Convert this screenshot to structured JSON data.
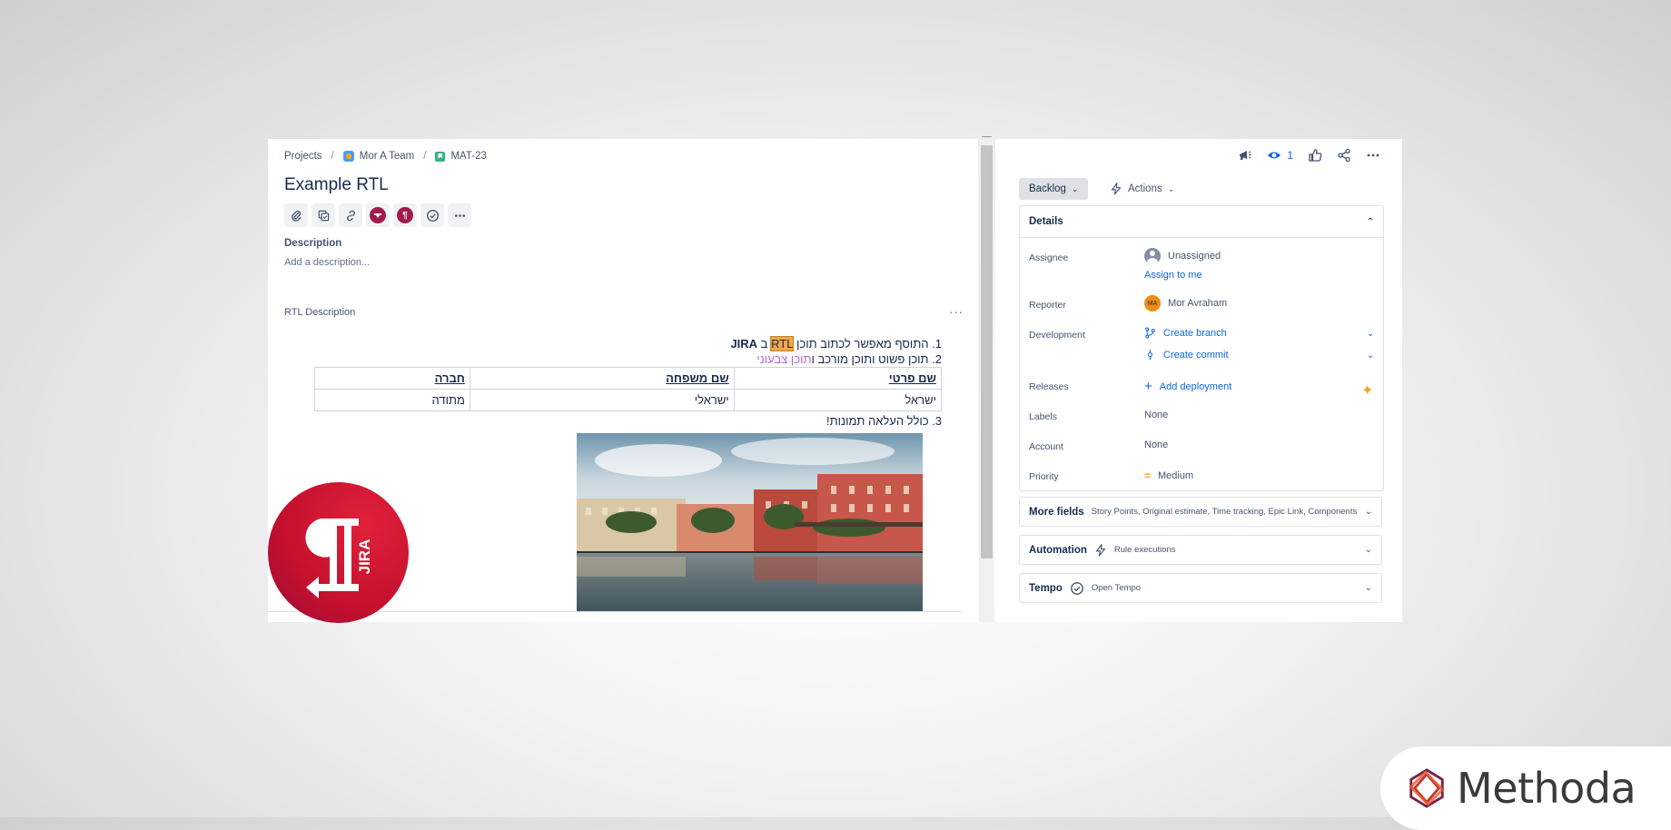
{
  "breadcrumb": {
    "projects": "Projects",
    "team": "Mor A Team",
    "issue_key": "MAT-23"
  },
  "issue": {
    "title": "Example RTL"
  },
  "toolbar": {
    "icons": [
      "paperclip-icon",
      "subtask-icon",
      "link-icon",
      "app-icon-1",
      "rtl-app-icon",
      "check-circle-icon",
      "more-icon"
    ]
  },
  "description": {
    "label": "Description",
    "placeholder": "Add a description..."
  },
  "rtl_field": {
    "label": "RTL Description",
    "more": "···",
    "line1_prefix": "1. התוסף מאפשר לכתוב תוכן ",
    "line1_highlight": "RTL",
    "line1_mid": " ב ",
    "line1_bold": "JIRA",
    "line2_prefix": "2. תוכן פשוט ותוכן מורכב ו",
    "line2_colored": "תוכן צבעוני",
    "table_headers": [
      "שם פרטי",
      "שם משפחה",
      "חברה"
    ],
    "table_row": [
      "ישראל",
      "ישראלי",
      "מתודה"
    ],
    "line3": "3. כולל העלאה תמונות!"
  },
  "sidebar": {
    "watch_count": "1",
    "status": "Backlog",
    "actions": "Actions",
    "details_title": "Details",
    "assignee_label": "Assignee",
    "assignee_value": "Unassigned",
    "assign_to_me": "Assign to me",
    "reporter_label": "Reporter",
    "reporter_initials": "MA",
    "reporter_value": "Mor Avraham",
    "development_label": "Development",
    "create_branch": "Create branch",
    "create_commit": "Create commit",
    "releases_label": "Releases",
    "add_deployment": "Add deployment",
    "labels_label": "Labels",
    "labels_value": "None",
    "account_label": "Account",
    "account_value": "None",
    "priority_label": "Priority",
    "priority_value": "Medium",
    "more_fields_title": "More fields",
    "more_fields_sub": "Story Points, Original estimate, Time tracking, Epic Link, Components, Fix ...",
    "automation_title": "Automation",
    "automation_sub": "Rule executions",
    "tempo_title": "Tempo",
    "tempo_sub": "Open Tempo"
  },
  "logo": {
    "text": "JIRA"
  },
  "branding": {
    "name": "Methoda"
  },
  "colors": {
    "accent": "#0c66e4",
    "rtl_red": "#c4102e",
    "highlight": "#f0a84b",
    "purple": "#b36bd8"
  }
}
